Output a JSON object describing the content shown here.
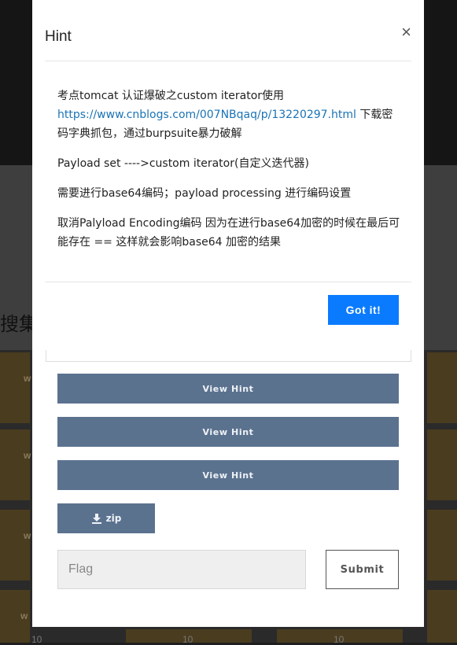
{
  "modal": {
    "title": "Hint",
    "close_symbol": "×",
    "body": {
      "p1_text_before": "考点tomcat 认证爆破之custom iterator使用",
      "p1_link": "https://www.cnblogs.com/007NBqaq/p/13220297.html",
      "p1_text_after": " 下载密码字典抓包，通过burpsuite暴力破解",
      "p2": "Payload set ---->custom iterator(自定义迭代器)",
      "p3": "需要进行base64编码；payload processing 进行编码设置",
      "p4": "取消Palyload Encoding编码 因为在进行base64加密的时候在最后可能存在 == 这样就会影响base64 加密的结果"
    },
    "confirm_label": "Got it!"
  },
  "challenge": {
    "hint_buttons": [
      "View Hint",
      "View Hint",
      "View Hint"
    ],
    "zip_label": "zip",
    "flag_placeholder": "Flag",
    "submit_label": "Submit"
  },
  "background": {
    "heading_fragment": "搜集",
    "tile_letter": "w",
    "tile_number": "10",
    "colors": {
      "accent_button": "#0a7bff",
      "hint_button": "#5b728f",
      "link": "#1a73b5"
    }
  }
}
